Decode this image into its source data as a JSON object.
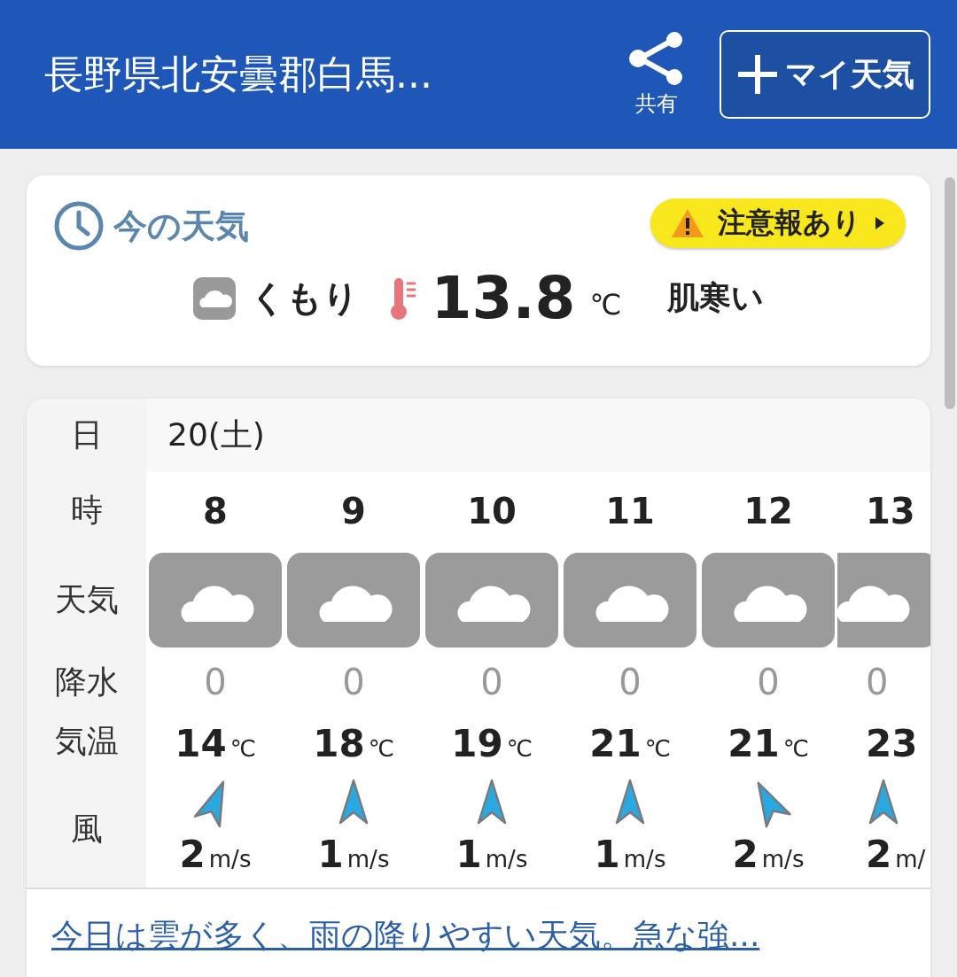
{
  "header": {
    "title": "長野県北安曇郡白馬...",
    "share_label": "共有",
    "my_weather_button": "マイ天気"
  },
  "current": {
    "title": "今の天気",
    "alert": "注意報あり",
    "condition": "くもり",
    "temperature": "13.8",
    "temp_unit": "℃",
    "feel": "肌寒い"
  },
  "forecast": {
    "row_labels": [
      "日",
      "時",
      "天気",
      "降水",
      "気温",
      "風"
    ],
    "date": "20(土)",
    "hours": [
      {
        "kind": "nne",
        "hour": "8",
        "precip": "0",
        "temp": "14",
        "temp_unit": "℃",
        "wind_speed": "2",
        "wind_unit": "m/s"
      },
      {
        "kind": "n",
        "hour": "9",
        "precip": "0",
        "temp": "18",
        "temp_unit": "℃",
        "wind_speed": "1",
        "wind_unit": "m/s"
      },
      {
        "kind": "n",
        "hour": "10",
        "precip": "0",
        "temp": "19",
        "temp_unit": "℃",
        "wind_speed": "1",
        "wind_unit": "m/s"
      },
      {
        "kind": "n",
        "hour": "11",
        "precip": "0",
        "temp": "21",
        "temp_unit": "℃",
        "wind_speed": "1",
        "wind_unit": "m/s"
      },
      {
        "kind": "nnw",
        "hour": "12",
        "precip": "0",
        "temp": "21",
        "temp_unit": "℃",
        "wind_speed": "2",
        "wind_unit": "m/s"
      },
      {
        "kind": "n",
        "hour": "13",
        "precip": "0",
        "temp": "23",
        "wind_speed": "2",
        "wind_unit": "m/"
      }
    ],
    "summary_link": "今日は雲が多く、雨の降りやすい天気。急な強..."
  }
}
